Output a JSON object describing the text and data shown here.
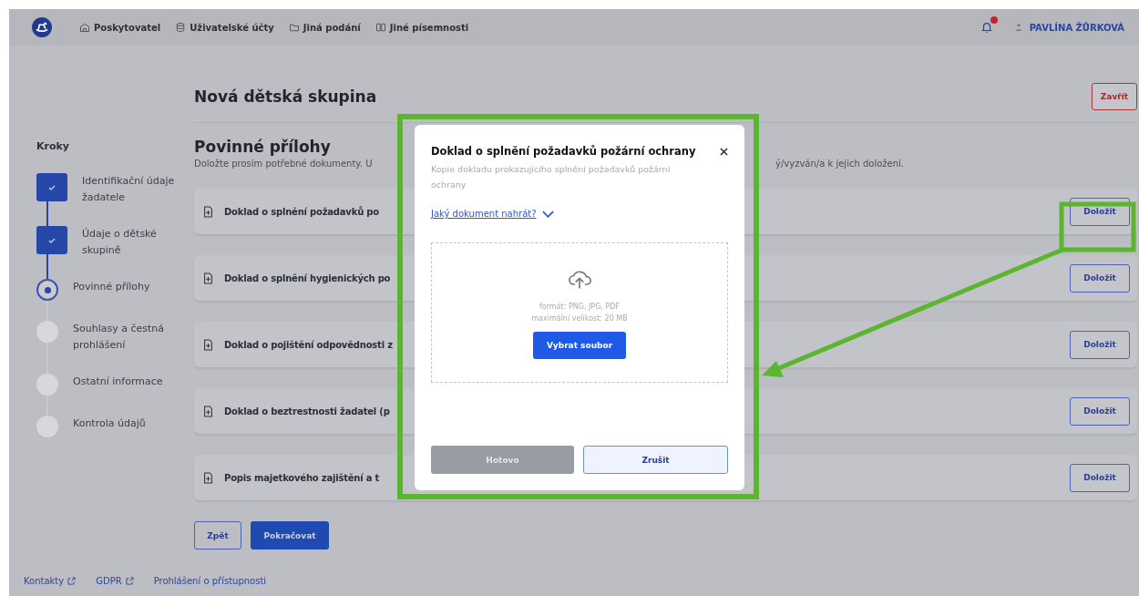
{
  "header": {
    "nav": [
      {
        "label": "Poskytovatel"
      },
      {
        "label": "Uživatelské účty"
      },
      {
        "label": "Jiná podání"
      },
      {
        "label": "Jiné písemnosti"
      }
    ],
    "notifications": {
      "unread": true
    },
    "user": "PAVLÍNA ŽŮRKOVÁ"
  },
  "sidebar": {
    "title": "Kroky",
    "steps": [
      {
        "label": "Identifikační údaje žadatele",
        "completed": true,
        "selected": false
      },
      {
        "label": "Údaje o dětské skupině",
        "completed": true,
        "selected": false
      },
      {
        "label": "Povinné přílohy",
        "completed": false,
        "selected": true
      },
      {
        "label": "Souhlasy a čestná prohlášení",
        "completed": false,
        "selected": false
      },
      {
        "label": "Ostatní informace",
        "completed": false,
        "selected": false
      },
      {
        "label": "Kontrola údajů",
        "completed": false,
        "selected": false
      }
    ]
  },
  "page": {
    "title": "Nová dětská skupina",
    "close_button": "Zavřít",
    "section_title": "Povinné přílohy",
    "subtitle_start": "Doložte prosím potřebné dokumenty. U",
    "subtitle_end": "ý/vyzván/a k jejich doložení.",
    "attachments": [
      {
        "label": "Doklad o splnění požadavků po",
        "button": "Doložit"
      },
      {
        "label": "Doklad o splnění hygienických po",
        "button": "Doložit"
      },
      {
        "label": "Doklad o pojištění odpovědnosti z",
        "button": "Doložit"
      },
      {
        "label": "Doklad o beztrestnosti žadatel (p",
        "button": "Doložit"
      },
      {
        "label": "Popis majetkového zajištění a t",
        "button": "Doložit"
      }
    ],
    "back_button": "Zpět",
    "continue_button": "Pokračovat"
  },
  "footer": {
    "links": [
      {
        "label": "Kontakty",
        "external": true
      },
      {
        "label": "GDPR",
        "external": true
      },
      {
        "label": "Prohlášení o přístupnosti",
        "external": false
      }
    ]
  },
  "modal": {
    "title": "Doklad o splnění požadavků požární ochrany",
    "description": "Kopie dokladu prokazujícího splnění požadavků požární ochrany",
    "help_link": "Jaký dokument nahrát?",
    "formats": "formát: PNG, JPG, PDF",
    "max_size": "maximální velikost: 20 MB",
    "select_button": "Vybrat soubor",
    "done_button": {
      "label": "Hotovo",
      "disabled": true
    },
    "cancel_button": "Zrušit"
  }
}
